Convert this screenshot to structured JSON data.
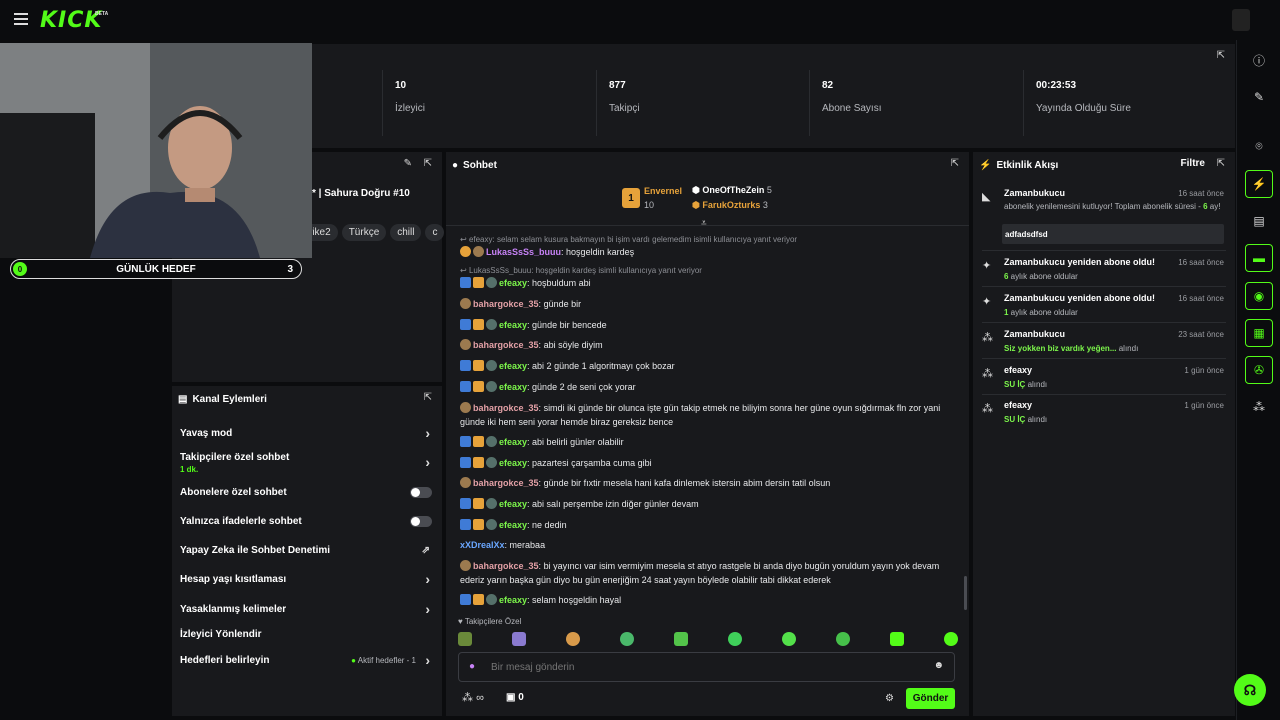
{
  "app": {
    "logo": "KICK",
    "beta": "BETA"
  },
  "stats": [
    {
      "value": "10",
      "label": "İzleyici"
    },
    {
      "value": "877",
      "label": "Takipçi"
    },
    {
      "value": "82",
      "label": "Abone Sayısı"
    },
    {
      "value": "00:23:53",
      "label": "Yayında Olduğu Süre"
    }
  ],
  "goal": {
    "count": "0",
    "title": "GÜNLÜK HEDEF",
    "target": "3"
  },
  "stream_info": {
    "title_fragment": "* | Sahura Doğru #10",
    "tags": [
      "rike2",
      "Türkçe",
      "chill",
      "c"
    ]
  },
  "channel_actions": {
    "title": "Kanal Eylemleri",
    "items": [
      {
        "label": "Yavaş mod",
        "type": "chevron"
      },
      {
        "label": "Takipçilere özel sohbet",
        "sub": "1 dk.",
        "type": "chevron"
      },
      {
        "label": "Abonelere özel sohbet",
        "type": "toggle"
      },
      {
        "label": "Yalnızca ifadelerle sohbet",
        "type": "toggle"
      },
      {
        "label": "Yapay Zeka ile Sohbet Denetimi",
        "type": "external"
      },
      {
        "label": "Hesap yaşı kısıtlaması",
        "type": "chevron"
      },
      {
        "label": "Yasaklanmış kelimeler",
        "type": "chevron"
      },
      {
        "label": "İzleyici Yönlendir",
        "type": "none"
      },
      {
        "label": "Hedefleri belirleyin",
        "type": "chevron",
        "status": "Aktif hedefler - 1"
      }
    ]
  },
  "chat": {
    "title": "Sohbet",
    "leaderboard": {
      "first": {
        "rank": "1",
        "name": "Envernel",
        "count": "10"
      },
      "others": [
        {
          "name": "OneOfTheZein",
          "count": "5"
        },
        {
          "name": "FarukOzturks",
          "count": "3"
        }
      ]
    },
    "messages": [
      {
        "reply": "efeaxy: selam selam kusura bakmayın bi işim vardı gelemedim isimli kullanıcıya yanıt veriyor"
      },
      {
        "user": "LukasSsSs_buuu",
        "color": "purple",
        "text": "hoşgeldin kardeş",
        "badges": "rank"
      },
      {
        "reply": "LukasSsSs_buuu: hoşgeldin kardeş isimli kullanıcıya yanıt veriyor"
      },
      {
        "user": "efeaxy",
        "color": "green",
        "text": "hoşbuldum abi",
        "badges": "full"
      },
      {
        "user": "bahargokce_35",
        "color": "pink",
        "text": "günde bir",
        "badges": "one"
      },
      {
        "user": "efeaxy",
        "color": "green",
        "text": "günde bir bencede",
        "badges": "full"
      },
      {
        "user": "bahargokce_35",
        "color": "pink",
        "text": "abi söyle diyim",
        "badges": "one"
      },
      {
        "user": "efeaxy",
        "color": "green",
        "text": "abi 2 günde 1 algoritmayı çok bozar",
        "badges": "full"
      },
      {
        "user": "efeaxy",
        "color": "green",
        "text": "günde 2 de seni çok yorar",
        "badges": "full"
      },
      {
        "user": "bahargokce_35",
        "color": "pink",
        "text": "simdi iki günde bir olunca işte gün takip etmek ne biliyim sonra her güne oyun sığdırmak fln zor yani günde iki hem seni yorar hemde biraz gereksiz bence",
        "badges": "one"
      },
      {
        "user": "efeaxy",
        "color": "green",
        "text": "abi belirli günler olabilir",
        "badges": "full"
      },
      {
        "user": "efeaxy",
        "color": "green",
        "text": "pazartesi çarşamba cuma gibi",
        "badges": "full"
      },
      {
        "user": "bahargokce_35",
        "color": "pink",
        "text": "günde bir fıxtir mesela hani kafa dinlemek istersin abim dersin tatil olsun",
        "badges": "one"
      },
      {
        "user": "efeaxy",
        "color": "green",
        "text": "abi salı perşembe izin diğer günler devam",
        "badges": "full"
      },
      {
        "user": "efeaxy",
        "color": "green",
        "text": "ne dedin",
        "badges": "full"
      },
      {
        "user": "xXDrealXx",
        "color": "blue",
        "text": "merabaa",
        "badges": "none"
      },
      {
        "user": "bahargokce_35",
        "color": "pink",
        "text": "bi yayıncı var isim vermiyim mesela st atıyo rastgele bi anda diyo bugün yoruldum yayın yok devam ederiz yarın başka gün diyo bu gün enerjiğim 24 saat yayın böylede olabilir tabi dikkat ederek",
        "badges": "one"
      },
      {
        "user": "efeaxy",
        "color": "green",
        "text": "selam hoşgeldin hayal",
        "badges": "full"
      }
    ],
    "emote_label": "Takipçilere Özel",
    "input_placeholder": "Bir mesaj gönderin",
    "points": "∞",
    "gift_count": "0",
    "send_label": "Gönder"
  },
  "activity": {
    "title": "Etkinlik Akışı",
    "filter": "Filtre",
    "events": [
      {
        "title": "Zamanbukucu",
        "time": "16 saat önce",
        "sub": "abonelik yenilemesini kutluyor! Toplam abonelik süresi - ",
        "sub_b": "6",
        "sub2": " ay!",
        "note": "adfadsdfsd"
      },
      {
        "title": "Zamanbukucu yeniden abone oldu!",
        "time": "16 saat önce",
        "sub_b": "6",
        "sub": " aylık abone oldular"
      },
      {
        "title": "Zamanbukucu yeniden abone oldu!",
        "time": "16 saat önce",
        "sub_b": "1",
        "sub": " aylık abone oldular"
      },
      {
        "title": "Zamanbukucu",
        "time": "23 saat önce",
        "sub_b": "Siz yokken biz vardık yeğen...",
        "sub": " alındı"
      },
      {
        "title": "efeaxy",
        "time": "1 gün önce",
        "sub_b": "SU İÇ",
        "sub": " alındı"
      },
      {
        "title": "efeaxy",
        "time": "1 gün önce",
        "sub_b": "SU İÇ",
        "sub": " alındı"
      }
    ]
  },
  "colors": {
    "accent": "#53fc18",
    "panel": "#18191c",
    "bg": "#0b0c0e"
  }
}
